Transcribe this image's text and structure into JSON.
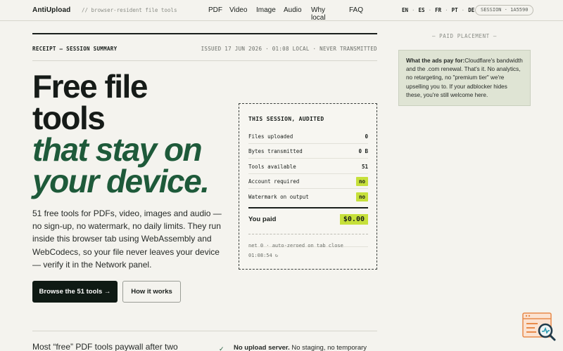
{
  "brand": {
    "name": "AntiUpload",
    "tagline": "// browser-resident file tools"
  },
  "nav": [
    "PDF",
    "Video",
    "Image",
    "Audio",
    "Why local",
    "FAQ"
  ],
  "languages": [
    "EN",
    "ES",
    "FR",
    "PT",
    "DE"
  ],
  "session_id": "SESSION · 1A5590",
  "receipt": {
    "title": "RECEIPT — SESSION SUMMARY",
    "issued": "ISSUED 17 JUN 2026 · 01:08 LOCAL · NEVER TRANSMITTED"
  },
  "hero": {
    "line1": "Free file",
    "line2": "tools",
    "line3": "that stay on",
    "line4": "your device."
  },
  "description": "51 free tools for PDFs, video, images and audio — no sign-up, no watermark, no daily limits. They run inside this browser tab using WebAssembly and WebCodecs, so your file never leaves your device — verify it in the Network panel.",
  "buttons": {
    "primary": "Browse the 51 tools →",
    "secondary": "How it works"
  },
  "audit": {
    "title": "THIS SESSION, AUDITED",
    "rows": [
      {
        "label": "Files uploaded",
        "value": "0"
      },
      {
        "label": "Bytes transmitted",
        "value": "0 B"
      },
      {
        "label": "Tools available",
        "value": "51"
      },
      {
        "label": "Account required",
        "value": "no"
      },
      {
        "label": "Watermark on output",
        "value": "no"
      }
    ],
    "total_label": "You paid",
    "total_value": "$0.00",
    "footer_line1": "net 0 · auto-zeroed on tab close",
    "footer_line2": "01:08:54 ↻"
  },
  "sidebar": {
    "paid_label": "— PAID PLACEMENT —",
    "ad_heading": "What the ads pay for:",
    "ad_body": "Cloudflare's bandwidth and the .com renewal. That's it. No analytics, no retargeting, no \"premium tier\" we're upselling you to. If your adblocker hides these, you're still welcome here."
  },
  "bottom": {
    "left": "Most “free” PDF tools paywall after two",
    "right_bold": "No upload server.",
    "right_rest": " No staging, no temporary"
  },
  "colors": {
    "background": "#f4f3ee",
    "accent_green": "#1e5a3a",
    "highlight": "#c6e03a",
    "primary_button": "#0f1a14",
    "ad_background": "#dfe4d4"
  }
}
